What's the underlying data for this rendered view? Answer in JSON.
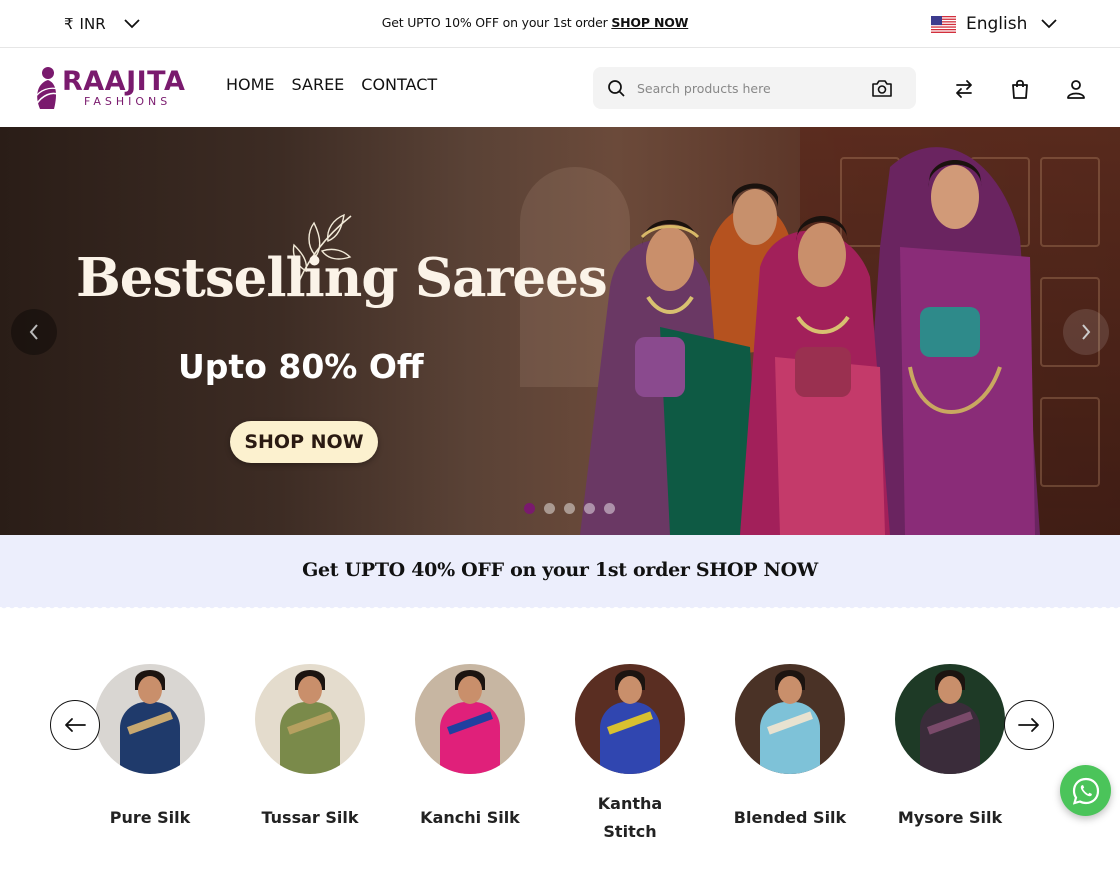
{
  "topbar": {
    "currency_symbol": "₹",
    "currency": "INR",
    "promo_text": "Get UPTO 10% OFF on your 1st order ",
    "promo_link": "SHOP NOW",
    "language": "English"
  },
  "header": {
    "logo_main": "RAAJITA",
    "logo_sub": "FASHIONS",
    "nav": [
      "HOME",
      "SAREE",
      "CONTACT"
    ],
    "search_placeholder": "Search products here",
    "icons": [
      "compare-icon",
      "bag-icon",
      "user-icon"
    ]
  },
  "hero": {
    "title": "Bestselling Sarees",
    "subtitle": "Upto 80% Off",
    "cta": "SHOP NOW",
    "slides_count": 5,
    "active_slide": 1
  },
  "promo_band": {
    "text": "Get UPTO 40% OFF on your 1st order SHOP NOW"
  },
  "categories": [
    {
      "label": "Pure Silk",
      "color": "#1f3a6b",
      "accent": "#c8a870",
      "bg": "#d9d6d2"
    },
    {
      "label": "Tussar Silk",
      "color": "#7a8a4a",
      "accent": "#b6a060",
      "bg": "#e4dccd"
    },
    {
      "label": "Kanchi Silk",
      "color": "#e0207a",
      "accent": "#2040a0",
      "bg": "#c7b6a2"
    },
    {
      "label": "Kantha Stitch",
      "color": "#3046b0",
      "accent": "#d8c030",
      "bg": "#5a2e22"
    },
    {
      "label": "Blended Silk",
      "color": "#7ec2d8",
      "accent": "#e8e2d0",
      "bg": "#4a3226"
    },
    {
      "label": "Mysore Silk",
      "color": "#3a2c3a",
      "accent": "#7a4a6a",
      "bg": "#1e3a26"
    }
  ],
  "colors": {
    "brand": "#7a1a6e",
    "promo_band_bg": "#eceefc",
    "whatsapp": "#4bc45a",
    "hero_button": "#fcf1cf"
  }
}
